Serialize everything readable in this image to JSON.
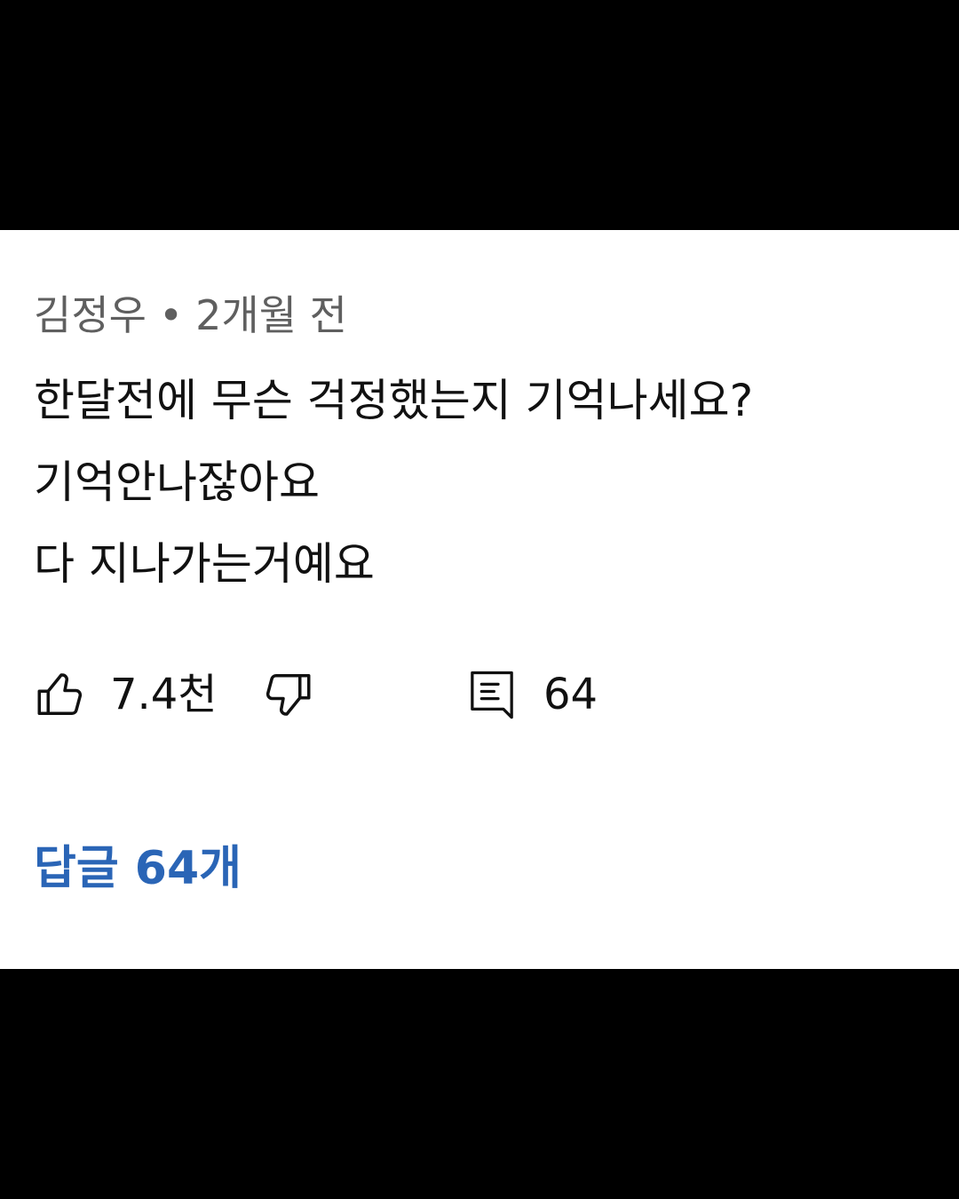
{
  "comment": {
    "author": "김정우",
    "separator": "•",
    "time": "2개월 전",
    "lines": [
      "한달전에 무슨 걱정했는지 기억나세요?",
      "기억안나잖아요",
      "다 지나가는거예요"
    ]
  },
  "actions": {
    "like_icon": "thumbs-up-icon",
    "like_count": "7.4천",
    "dislike_icon": "thumbs-down-icon",
    "reply_icon": "comment-icon",
    "reply_count": "64"
  },
  "replies": {
    "label": "답글 64개"
  },
  "colors": {
    "link": "#2a65b6",
    "meta_text": "#5f5f5f",
    "body_text": "#111111",
    "background": "#ffffff",
    "frame": "#000000"
  }
}
